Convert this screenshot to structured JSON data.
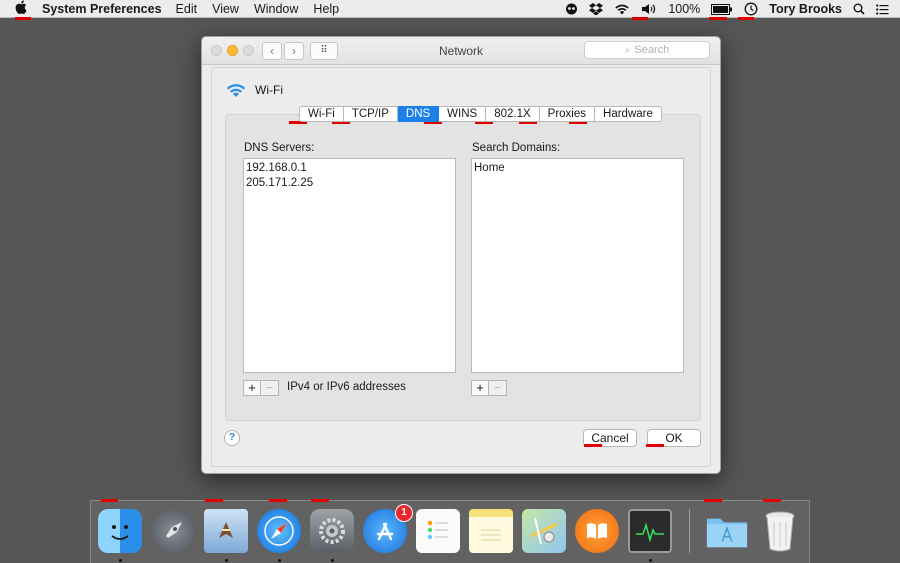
{
  "menubar": {
    "apple_icon": "apple-icon",
    "app_name": "System Preferences",
    "items": [
      "Edit",
      "View",
      "Window",
      "Help"
    ],
    "battery_text": "100%",
    "user_name": "Tory Brooks"
  },
  "window": {
    "title": "Network",
    "search_placeholder": "Search",
    "interface_name": "Wi-Fi",
    "tabs": [
      "Wi-Fi",
      "TCP/IP",
      "DNS",
      "WINS",
      "802.1X",
      "Proxies",
      "Hardware"
    ],
    "active_tab": "DNS",
    "dns": {
      "label": "DNS Servers:",
      "servers": [
        "192.168.0.1",
        "205.171.2.25"
      ],
      "hint": "IPv4 or IPv6 addresses"
    },
    "search_domains": {
      "label": "Search Domains:",
      "domains": [
        "Home"
      ]
    },
    "help_label": "?",
    "plus_label": "+",
    "minus_label": "−",
    "cancel_label": "Cancel",
    "ok_label": "OK"
  },
  "dock": {
    "items": [
      {
        "name": "Finder",
        "icon": "finder-icon",
        "running": true
      },
      {
        "name": "Launchpad",
        "icon": "launchpad-icon",
        "running": false
      },
      {
        "name": "Mail",
        "icon": "mail-icon",
        "running": true
      },
      {
        "name": "Safari",
        "icon": "safari-icon",
        "running": true
      },
      {
        "name": "System Preferences",
        "icon": "system-preferences-icon",
        "running": true
      },
      {
        "name": "App Store",
        "icon": "app-store-icon",
        "running": false,
        "badge": "1"
      },
      {
        "name": "Reminders",
        "icon": "reminders-icon",
        "running": false
      },
      {
        "name": "Notes",
        "icon": "notes-icon",
        "running": false
      },
      {
        "name": "Maps",
        "icon": "maps-icon",
        "running": false
      },
      {
        "name": "iBooks",
        "icon": "ibooks-icon",
        "running": false
      },
      {
        "name": "Activity Monitor",
        "icon": "activity-monitor-icon",
        "running": true
      },
      {
        "name": "Applications",
        "icon": "applications-folder-icon",
        "running": false
      },
      {
        "name": "Trash",
        "icon": "trash-icon",
        "running": false
      }
    ]
  },
  "colors": {
    "desktop": "#565656",
    "active_tab": "#1d7fe8",
    "annotation_mark": "#e00000",
    "badge": "#e8262d"
  }
}
